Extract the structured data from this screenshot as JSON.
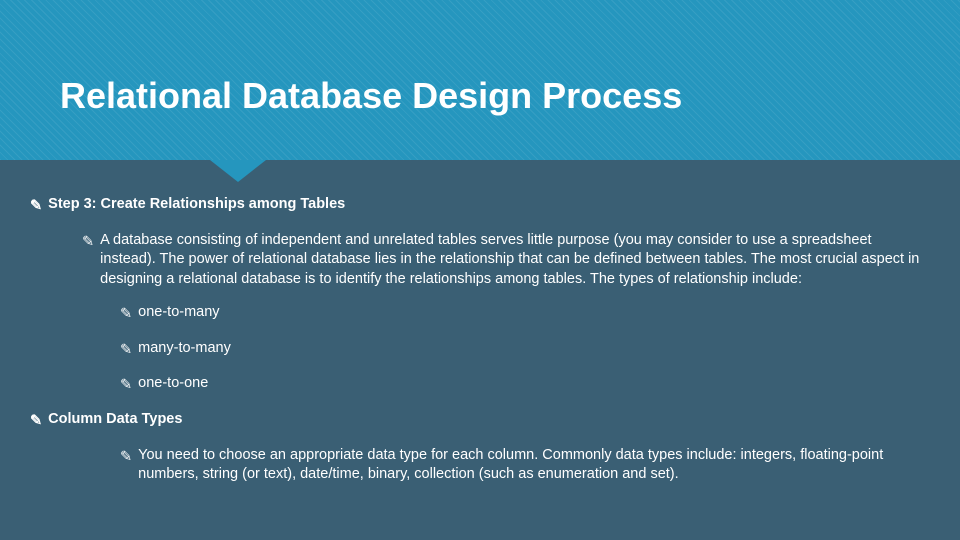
{
  "title": "Relational Database Design Process",
  "bullet_glyph": "✎",
  "items": {
    "step3": "Step 3: Create Relationships among Tables",
    "step3_desc": "A database consisting of independent and unrelated tables serves little purpose (you may consider to use a spreadsheet instead). The power of relational database lies in the relationship that can be defined between tables. The most crucial aspect in designing a relational database is to identify the relationships among tables. The types of relationship include:",
    "rel1": "one-to-many",
    "rel2": "many-to-many",
    "rel3": "one-to-one",
    "coltypes": "Column Data Types",
    "coltypes_desc": "You need to choose an appropriate data type for each column. Commonly data types include: integers, floating-point numbers, string (or text), date/time, binary, collection (such as enumeration and set)."
  }
}
